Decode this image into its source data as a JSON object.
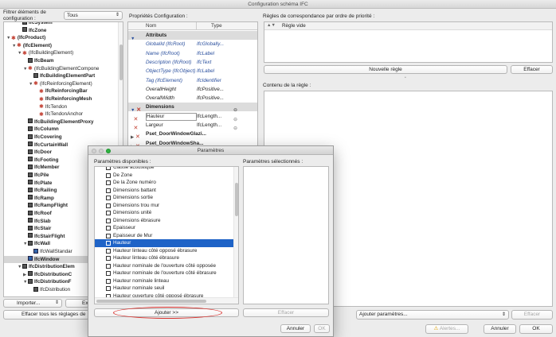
{
  "window": {
    "title": "Configuration schéma IFC"
  },
  "filter": {
    "label": "Filtrer éléments de configuration :",
    "value": "Tous"
  },
  "tree": {
    "items": [
      {
        "label": "IfcSystem",
        "depth": 3,
        "icon": "cube",
        "expander": "",
        "bold": true
      },
      {
        "label": "IfcZone",
        "depth": 3,
        "icon": "cube",
        "expander": "",
        "bold": true
      },
      {
        "label": "(IfcProduct)",
        "depth": 1,
        "icon": "star",
        "expander": "▼",
        "bold": true
      },
      {
        "label": "(IfcElement)",
        "depth": 2,
        "icon": "star",
        "expander": "▼",
        "bold": true
      },
      {
        "label": "(IfcBuildingElement)",
        "depth": 3,
        "icon": "star",
        "expander": "▼",
        "bold": false
      },
      {
        "label": "IfcBeam",
        "depth": 4,
        "icon": "cube",
        "expander": "",
        "bold": true
      },
      {
        "label": "(IfcBuildingElementCompone",
        "depth": 4,
        "icon": "star",
        "expander": "▼",
        "bold": false
      },
      {
        "label": "IfcBuildingElementPart",
        "depth": 5,
        "icon": "cube",
        "expander": "",
        "bold": true
      },
      {
        "label": "(IfcReinforcingElement)",
        "depth": 5,
        "icon": "star",
        "expander": "▼",
        "bold": false
      },
      {
        "label": "IfcReinforcingBar",
        "depth": 6,
        "icon": "star",
        "expander": "",
        "bold": true
      },
      {
        "label": "IfcReinforcingMesh",
        "depth": 6,
        "icon": "star",
        "expander": "",
        "bold": true
      },
      {
        "label": "IfcTendon",
        "depth": 6,
        "icon": "star",
        "expander": "",
        "bold": false
      },
      {
        "label": "IfcTendonAnchor",
        "depth": 6,
        "icon": "star",
        "expander": "",
        "bold": false
      },
      {
        "label": "IfcBuildingElementProxy",
        "depth": 4,
        "icon": "cube",
        "expander": "",
        "bold": true
      },
      {
        "label": "IfcColumn",
        "depth": 4,
        "icon": "cube",
        "expander": "",
        "bold": true
      },
      {
        "label": "IfcCovering",
        "depth": 4,
        "icon": "cube",
        "expander": "",
        "bold": true
      },
      {
        "label": "IfcCurtainWall",
        "depth": 4,
        "icon": "cube",
        "expander": "",
        "bold": true
      },
      {
        "label": "IfcDoor",
        "depth": 4,
        "icon": "cube",
        "expander": "",
        "bold": true
      },
      {
        "label": "IfcFooting",
        "depth": 4,
        "icon": "cube",
        "expander": "",
        "bold": true
      },
      {
        "label": "IfcMember",
        "depth": 4,
        "icon": "cube",
        "expander": "",
        "bold": true
      },
      {
        "label": "IfcPile",
        "depth": 4,
        "icon": "cube",
        "expander": "",
        "bold": true
      },
      {
        "label": "IfcPlate",
        "depth": 4,
        "icon": "cube",
        "expander": "",
        "bold": true
      },
      {
        "label": "IfcRailing",
        "depth": 4,
        "icon": "cube",
        "expander": "",
        "bold": true
      },
      {
        "label": "IfcRamp",
        "depth": 4,
        "icon": "cube",
        "expander": "",
        "bold": true
      },
      {
        "label": "IfcRampFlight",
        "depth": 4,
        "icon": "cube",
        "expander": "",
        "bold": true
      },
      {
        "label": "IfcRoof",
        "depth": 4,
        "icon": "cube",
        "expander": "",
        "bold": true
      },
      {
        "label": "IfcSlab",
        "depth": 4,
        "icon": "cube",
        "expander": "",
        "bold": true
      },
      {
        "label": "IfcStair",
        "depth": 4,
        "icon": "cube",
        "expander": "",
        "bold": true
      },
      {
        "label": "IfcStairFlight",
        "depth": 4,
        "icon": "cube",
        "expander": "",
        "bold": true
      },
      {
        "label": "IfcWall",
        "depth": 4,
        "icon": "cube",
        "expander": "▼",
        "bold": true
      },
      {
        "label": "IfcWallStandar",
        "depth": 5,
        "icon": "wall",
        "expander": "",
        "bold": false
      },
      {
        "label": "IfcWindow",
        "depth": 4,
        "icon": "wall",
        "expander": "",
        "bold": true,
        "selected": true
      },
      {
        "label": "IfcDistributionElem",
        "depth": 3,
        "icon": "cube",
        "expander": "▼",
        "bold": true
      },
      {
        "label": "IfcDistributionC",
        "depth": 4,
        "icon": "cube",
        "expander": "▶",
        "bold": true
      },
      {
        "label": "IfcDistributionF",
        "depth": 4,
        "icon": "cube",
        "expander": "▼",
        "bold": true
      },
      {
        "label": "IfcDistribution",
        "depth": 5,
        "icon": "cube",
        "expander": "",
        "bold": false
      }
    ]
  },
  "left_buttons": {
    "import": "Importer...",
    "export": "Ex",
    "reset": "Effacer tous les réglages de"
  },
  "properties": {
    "title": "Propriétés Configuration :",
    "col_name": "Nom",
    "col_type": "Type",
    "rows": [
      {
        "kind": "group",
        "name": "Attributs",
        "type": ""
      },
      {
        "kind": "attr",
        "name": "GlobalId (IfcRoot)",
        "type": "IfcGlobally..."
      },
      {
        "kind": "attr",
        "name": "Name (IfcRoot)",
        "type": "IfcLabel"
      },
      {
        "kind": "attr",
        "name": "Description (IfcRoot)",
        "type": "IfcText"
      },
      {
        "kind": "attr",
        "name": "ObjectType (IfcObject)",
        "type": "IfcLabel"
      },
      {
        "kind": "attr",
        "name": "Tag (IfcElement)",
        "type": "IfcIdentifier"
      },
      {
        "kind": "attr2",
        "name": "OverallHeight",
        "type": "IfcPositive..."
      },
      {
        "kind": "attr2",
        "name": "OverallWidth",
        "type": "IfcPositive..."
      },
      {
        "kind": "group",
        "name": "Dimensions",
        "type": ""
      },
      {
        "kind": "prop",
        "name": "Hauteur",
        "type": "IfcLength..."
      },
      {
        "kind": "prop",
        "name": "Largeur",
        "type": "IfcLength..."
      },
      {
        "kind": "pset",
        "name": "Pset_DoorWindowGlazi...",
        "type": ""
      },
      {
        "kind": "pset",
        "name": "Pset_DoorWindowSha...",
        "type": ""
      }
    ]
  },
  "rules": {
    "title": "Règles de correspondance par ordre de priorité :",
    "rule_empty": "Règle vide",
    "new_rule": "Nouvelle règle",
    "delete": "Effacer",
    "content_title": "Contenu de la règle :",
    "add_params": "Ajouter paramètres...",
    "delete2": "Effacer"
  },
  "footer": {
    "alerts": "Alertes...",
    "cancel": "Annuler",
    "ok": "OK"
  },
  "dialog": {
    "title": "Paramètres",
    "available_label": "Paramètres disponibles :",
    "selected_label": "Paramètres sélectionnés :",
    "items": [
      "Classe acoustique",
      "De Zone",
      "De la Zone numéro",
      "Dimensions battant",
      "Dimensions sortie",
      "Dimensions trou mur",
      "Dimensions unité",
      "Dimensions ébrasure",
      "Epaisseur",
      "Epaisseur de Mur",
      "Hauteur",
      "Hauteur linteau côté opposé ébrasure",
      "Hauteur linteau côté ébrasure",
      "Hauteur nominale de l'ouverture côté opposée",
      "Hauteur nominale de l'ouverture côté ébrasure",
      "Hauteur nominale linteau",
      "Hauteur nominale seuil",
      "Hauteur ouverture côté opposé ébrasure"
    ],
    "selected_index": 10,
    "add_button": "Ajouter >>",
    "delete_button": "Effacer",
    "cancel": "Annuler",
    "ok": "OK"
  },
  "colors": {
    "accent": "#1e63c7",
    "annotation": "#d9302c"
  }
}
